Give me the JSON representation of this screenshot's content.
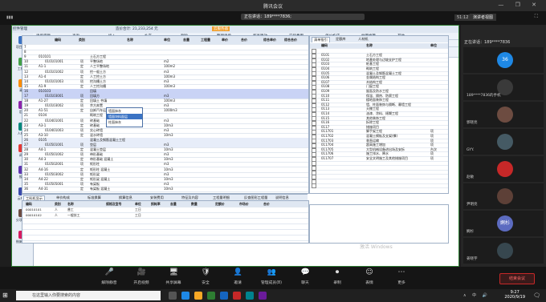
{
  "meeting": {
    "title": "腾讯会议",
    "speaking_text": "正在讲话：189****7836;",
    "timer": "51:12",
    "gallery_label": "演讲者视图",
    "sidebar_speaking": "正在讲话：189****7836",
    "participants": [
      {
        "name": "",
        "avatar_text": "36",
        "color": "#1e88e5"
      },
      {
        "name": "189****7836的手机",
        "avatar_text": "",
        "color": "#3a3a3a"
      },
      {
        "name": "郭晓亮",
        "avatar_text": "",
        "color": "#6d4c41"
      },
      {
        "name": "GYY.",
        "avatar_text": "",
        "color": "#455a64"
      },
      {
        "name": "赵敏",
        "avatar_text": "",
        "color": "#c62828"
      },
      {
        "name": "尹明亮",
        "avatar_text": "",
        "color": "#5d4037"
      },
      {
        "name": "婀杉",
        "avatar_text": "婀杉",
        "color": "#5c6bc0"
      },
      {
        "name": "姜晓宇",
        "avatar_text": "",
        "color": "#37474f"
      }
    ],
    "toolbar": [
      {
        "label": "解除静音",
        "icon": "🎤"
      },
      {
        "label": "开启视频",
        "icon": "🎥"
      },
      {
        "label": "共享屏幕",
        "icon": "🖥"
      },
      {
        "label": "安全",
        "icon": "🛡"
      },
      {
        "label": "邀请",
        "icon": "👤"
      },
      {
        "label": "管理成员(8)",
        "icon": "👥"
      },
      {
        "label": "聊天",
        "icon": "💬"
      },
      {
        "label": "录制",
        "icon": "⏺"
      },
      {
        "label": "表情",
        "icon": "☺"
      },
      {
        "label": "更多",
        "icon": "⋯"
      }
    ],
    "leave_label": "结束会议"
  },
  "app": {
    "top_labels": [
      "控件管理",
      "工程信息",
      "造价分析",
      "分部分项",
      "措施项目",
      "其他项目",
      "人材机汇总",
      "费用汇总",
      "报表"
    ],
    "total_label": "造价合计: 21,233,254 元",
    "upgrade_label": "云服务器",
    "nav": [
      {
        "label": "项目自检",
        "color": "#3b73c4"
      },
      {
        "label": "工程量",
        "color": "#43a047"
      },
      {
        "label": "清单",
        "color": "#fb8c00"
      },
      {
        "label": "定额",
        "color": "#8e24aa"
      },
      {
        "label": "人材机",
        "color": "#00897b"
      },
      {
        "label": "调价",
        "color": "#e53935"
      },
      {
        "label": "报表",
        "color": "#5e35b1"
      },
      {
        "label": "云检查",
        "color": "#3949ab"
      },
      {
        "label": "分项工程",
        "color": "#6d4c41"
      },
      {
        "label": "措施项目",
        "color": "#d81b60"
      }
    ],
    "tool_row1": [
      "清单定额",
      "查询",
      "插入",
      "补充",
      "删除",
      "整理清单",
      "超高降效",
      "安装费用",
      "单价构成",
      "批量换算",
      "其他"
    ],
    "tool_row2": [
      "工程名称",
      "编码",
      "类别",
      "名称",
      "项目特征",
      "单位",
      "工程量表达式",
      "工程量",
      "单价",
      "合价"
    ],
    "main_headers": [
      "编码",
      "类别",
      "名称",
      "单位",
      "含量",
      "工程量",
      "单价",
      "合价",
      "综合单价",
      "综合合价"
    ],
    "main_rows": [
      {
        "no": "7",
        "code": "",
        "type": "",
        "name": "",
        "unit": "",
        "qty": "",
        "price": "",
        "total": "",
        "style": ""
      },
      {
        "no": "8",
        "code": "",
        "type": "",
        "name": "",
        "unit": "",
        "qty": "",
        "price": "",
        "total": "",
        "style": ""
      },
      {
        "no": "9",
        "code": "010101",
        "type": "",
        "name": "土石方工程",
        "unit": "",
        "qty": "",
        "price": "",
        "total": "",
        "style": ""
      },
      {
        "no": "10",
        "code": "010101001",
        "type": "项",
        "name": "平整场地",
        "unit": "m2",
        "qty": "",
        "price": "",
        "total": "",
        "style": ""
      },
      {
        "no": "11",
        "code": "A1-1",
        "type": "定",
        "name": "人工平整场地",
        "unit": "100m2",
        "qty": "",
        "price": "",
        "total": "",
        "style": ""
      },
      {
        "no": "12",
        "code": "010101002",
        "type": "项",
        "name": "挖一般土方",
        "unit": "m3",
        "qty": "",
        "price": "",
        "total": "",
        "style": ""
      },
      {
        "no": "13",
        "code": "A1-4",
        "type": "定",
        "name": "人工挖土方",
        "unit": "100m3",
        "qty": "",
        "price": "",
        "total": "",
        "style": ""
      },
      {
        "no": "14",
        "code": "010101003",
        "type": "项",
        "name": "挖沟槽土方",
        "unit": "m3",
        "qty": "",
        "price": "",
        "total": "",
        "style": ""
      },
      {
        "no": "15",
        "code": "A1-9",
        "type": "定",
        "name": "人工挖沟槽",
        "unit": "100m3",
        "qty": "",
        "price": "",
        "total": "",
        "style": ""
      },
      {
        "no": "16",
        "code": "010103",
        "type": "",
        "name": "回填",
        "unit": "",
        "qty": "",
        "price": "",
        "total": "",
        "style": "hl"
      },
      {
        "no": "17",
        "code": "010103001",
        "type": "项",
        "name": "回填方",
        "unit": "m3",
        "qty": "",
        "price": "",
        "total": "",
        "style": "hl"
      },
      {
        "no": "18",
        "code": "A1-27",
        "type": "定",
        "name": "回填土 夯填",
        "unit": "100m3",
        "qty": "",
        "price": "",
        "total": "",
        "style": ""
      },
      {
        "no": "19",
        "code": "010103002",
        "type": "项",
        "name": "余方弃置",
        "unit": "m3",
        "qty": "",
        "price": "",
        "total": "",
        "style": ""
      },
      {
        "no": "20",
        "code": "A1-51",
        "type": "定",
        "name": "自卸汽车运土",
        "unit": "1000m3",
        "qty": "",
        "price": "",
        "total": "",
        "style": ""
      },
      {
        "no": "21",
        "code": "0104",
        "type": "",
        "name": "砌筑工程",
        "unit": "",
        "qty": "",
        "price": "",
        "total": "",
        "style": ""
      },
      {
        "no": "22",
        "code": "010401001",
        "type": "项",
        "name": "砖基础",
        "unit": "m3",
        "qty": "",
        "price": "",
        "total": "",
        "style": ""
      },
      {
        "no": "23",
        "code": "A3-1",
        "type": "定",
        "name": "砖基础",
        "unit": "10m3",
        "qty": "",
        "price": "",
        "total": "",
        "style": ""
      },
      {
        "no": "24",
        "code": "010401003",
        "type": "项",
        "name": "实心砖墙",
        "unit": "m3",
        "qty": "",
        "price": "",
        "total": "",
        "style": ""
      },
      {
        "no": "25",
        "code": "A3-10",
        "type": "定",
        "name": "混水砖墙",
        "unit": "10m3",
        "qty": "",
        "price": "",
        "total": "",
        "style": ""
      },
      {
        "no": "26",
        "code": "0105",
        "type": "",
        "name": "混凝土及钢筋混凝土工程",
        "unit": "",
        "qty": "",
        "price": "",
        "total": "",
        "style": "sel"
      },
      {
        "no": "27",
        "code": "010501001",
        "type": "项",
        "name": "垫层",
        "unit": "m3",
        "qty": "",
        "price": "",
        "total": "",
        "style": "sel"
      },
      {
        "no": "28",
        "code": "A4-1",
        "type": "定",
        "name": "混凝土垫层",
        "unit": "10m3",
        "qty": "",
        "price": "",
        "total": "",
        "style": ""
      },
      {
        "no": "29",
        "code": "010501002",
        "type": "项",
        "name": "带形基础",
        "unit": "m3",
        "qty": "",
        "price": "",
        "total": "",
        "style": ""
      },
      {
        "no": "30",
        "code": "A4-3",
        "type": "定",
        "name": "带形基础 混凝土",
        "unit": "10m3",
        "qty": "",
        "price": "",
        "total": "",
        "style": ""
      },
      {
        "no": "31",
        "code": "010502001",
        "type": "项",
        "name": "矩形柱",
        "unit": "m3",
        "qty": "",
        "price": "",
        "total": "",
        "style": ""
      },
      {
        "no": "32",
        "code": "A4-16",
        "type": "定",
        "name": "矩形柱 混凝土",
        "unit": "10m3",
        "qty": "",
        "price": "",
        "total": "",
        "style": ""
      },
      {
        "no": "33",
        "code": "010503002",
        "type": "项",
        "name": "矩形梁",
        "unit": "m3",
        "qty": "",
        "price": "",
        "total": "",
        "style": ""
      },
      {
        "no": "34",
        "code": "A4-22",
        "type": "定",
        "name": "矩形梁 混凝土",
        "unit": "10m3",
        "qty": "",
        "price": "",
        "total": "",
        "style": ""
      },
      {
        "no": "35",
        "code": "010505001",
        "type": "项",
        "name": "有梁板",
        "unit": "m3",
        "qty": "",
        "price": "",
        "total": "",
        "style": ""
      },
      {
        "no": "36",
        "code": "A4-31",
        "type": "定",
        "name": "有梁板 混凝土",
        "unit": "10m3",
        "qty": "",
        "price": "",
        "total": "",
        "style": ""
      }
    ],
    "dropdown": [
      "墙面抹灰",
      "墙面块料面层",
      "柱面抹灰"
    ],
    "right_tabs": [
      "清单指引",
      "定额库",
      "人材机"
    ],
    "right_headers": [
      "编码",
      "名称",
      "单位"
    ],
    "right_rows": [
      {
        "code": "",
        "name": "",
        "unit": ""
      },
      {
        "code": "0101",
        "name": "土石方工程",
        "unit": ""
      },
      {
        "code": "0102",
        "name": "地基处理与边坡支护工程",
        "unit": ""
      },
      {
        "code": "0103",
        "name": "桩基工程",
        "unit": ""
      },
      {
        "code": "0104",
        "name": "砌筑工程",
        "unit": ""
      },
      {
        "code": "0105",
        "name": "混凝土及钢筋混凝土工程",
        "unit": ""
      },
      {
        "code": "0106",
        "name": "金属结构工程",
        "unit": ""
      },
      {
        "code": "0107",
        "name": "木结构工程",
        "unit": ""
      },
      {
        "code": "0108",
        "name": "门窗工程",
        "unit": ""
      },
      {
        "code": "0109",
        "name": "屋面及防水工程",
        "unit": ""
      },
      {
        "code": "0110",
        "name": "保温、隔热、防腐工程",
        "unit": ""
      },
      {
        "code": "0111",
        "name": "楼地面装饰工程",
        "unit": ""
      },
      {
        "code": "0112",
        "name": "墙、柱面装饰与隔断、幕墙工程",
        "unit": ""
      },
      {
        "code": "0113",
        "name": "天棚工程",
        "unit": ""
      },
      {
        "code": "0114",
        "name": "油漆、涂料、裱糊工程",
        "unit": ""
      },
      {
        "code": "0115",
        "name": "其他装饰工程",
        "unit": ""
      },
      {
        "code": "0116",
        "name": "拆除工程",
        "unit": ""
      },
      {
        "code": "0117",
        "name": "措施项目",
        "unit": ""
      },
      {
        "code": "011701",
        "name": "脚手架工程",
        "unit": "项"
      },
      {
        "code": "011702",
        "name": "混凝土模板及支架(撑)",
        "unit": "项"
      },
      {
        "code": "011703",
        "name": "垂直运输",
        "unit": "项"
      },
      {
        "code": "011704",
        "name": "超高施工增加",
        "unit": "项"
      },
      {
        "code": "011705",
        "name": "大型机械设备进出场及安拆",
        "unit": "台次"
      },
      {
        "code": "011706",
        "name": "施工排水、降水",
        "unit": "项"
      },
      {
        "code": "011707",
        "name": "安全文明施工及其他措施项目",
        "unit": "项"
      },
      {
        "code": "",
        "name": "",
        "unit": ""
      },
      {
        "code": "",
        "name": "",
        "unit": ""
      },
      {
        "code": "",
        "name": "",
        "unit": ""
      },
      {
        "code": "",
        "name": "",
        "unit": ""
      },
      {
        "code": "",
        "name": "",
        "unit": ""
      },
      {
        "code": "",
        "name": "",
        "unit": ""
      }
    ],
    "bottom_tabs": [
      "工料机显示",
      "单价构成",
      "标准换算",
      "换算信息",
      "安装费用",
      "特征及内容",
      "工程量明细",
      "反查图形工程量",
      "说明信息"
    ],
    "bottom_headers": [
      "编码",
      "类别",
      "名称",
      "规格及型号",
      "单位",
      "损耗率",
      "含量",
      "数量",
      "定额价",
      "市场价",
      "合价"
    ],
    "bottom_rows": [
      {
        "code": "00010101",
        "type": "人",
        "name": "普工",
        "spec": "",
        "unit": "工日",
        "qty": "",
        "price": ""
      },
      {
        "code": "00010102",
        "type": "人",
        "name": "一般技工",
        "spec": "",
        "unit": "工日",
        "qty": "",
        "price": ""
      },
      {
        "code": "",
        "type": "",
        "name": "",
        "spec": "",
        "unit": "",
        "qty": "",
        "price": ""
      },
      {
        "code": "",
        "type": "",
        "name": "",
        "spec": "",
        "unit": "",
        "qty": "",
        "price": ""
      },
      {
        "code": "",
        "type": "",
        "name": "",
        "spec": "",
        "unit": "",
        "qty": "",
        "price": ""
      },
      {
        "code": "",
        "type": "",
        "name": "",
        "spec": "",
        "unit": "",
        "qty": "",
        "price": ""
      }
    ],
    "watermark": "激活 Windows"
  },
  "taskbar": {
    "search_placeholder": "在这里输入你要搜索的内容",
    "time": "9:27",
    "date": "2020/9/19",
    "tray": "∧ 中 🔊"
  }
}
